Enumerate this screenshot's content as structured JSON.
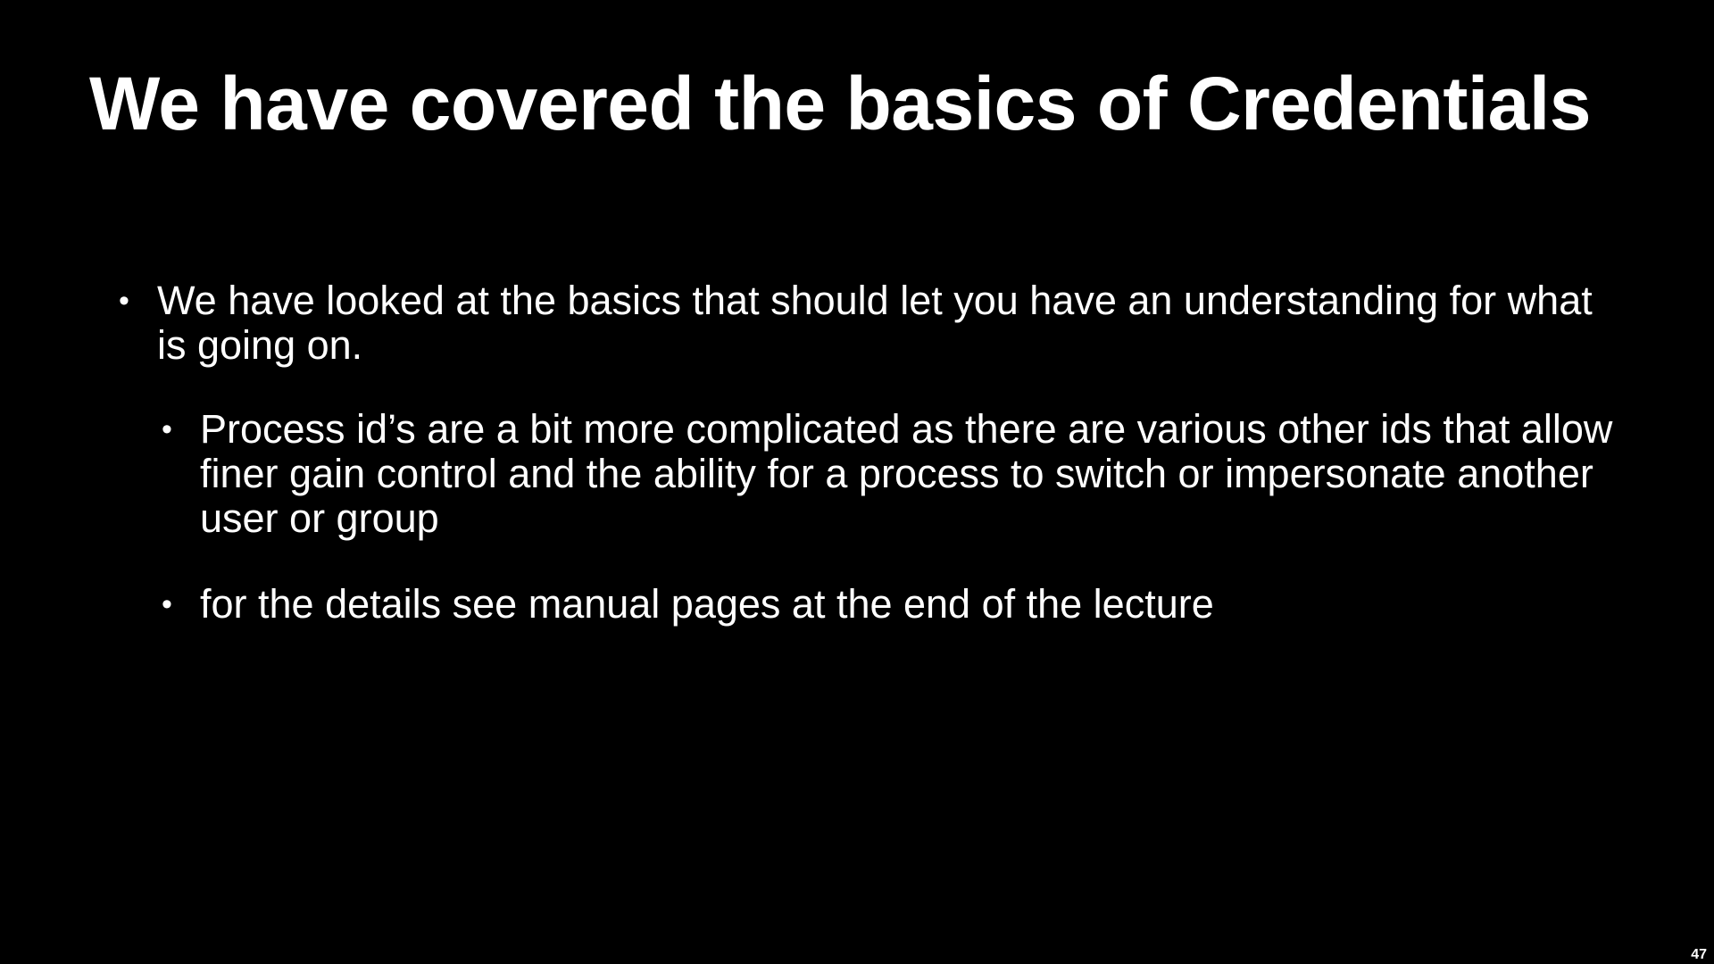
{
  "slide": {
    "title": "We have covered the basics of Credentials",
    "bullets": [
      {
        "marker": "•",
        "text": "We have looked at the basics that should let you have an understanding for what is going on."
      },
      {
        "marker": "•",
        "text": "Process id’s are a bit more complicated as there are various other ids that allow finer gain control and the ability for a process to switch or impersonate another user or group"
      },
      {
        "marker": "•",
        "text": "for the details see manual pages at the end of the lecture"
      }
    ],
    "page_number": "47"
  },
  "colors": {
    "background": "#000000",
    "text": "#ffffff"
  }
}
